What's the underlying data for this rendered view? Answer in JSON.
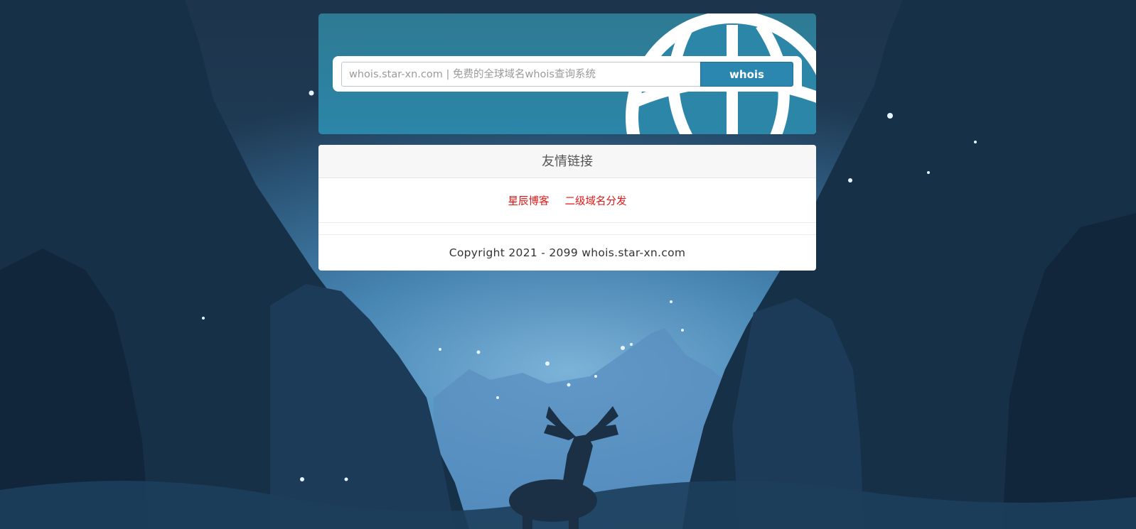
{
  "search": {
    "placeholder": "whois.star-xn.com | 免费的全球域名whois查询系统",
    "button_label": "whois"
  },
  "friend_links": {
    "title": "友情链接",
    "items": [
      {
        "label": "星辰博客"
      },
      {
        "label": "二级域名分发"
      }
    ]
  },
  "footer": {
    "copyright": "Copyright 2021 - 2099 whois.star-xn.com"
  },
  "colors": {
    "hero_bg": "#2c86a8",
    "button_bg": "#2c87b0",
    "link_color": "#e01515",
    "scene_dark": "#163048",
    "scene_light": "#5fa9d9"
  }
}
